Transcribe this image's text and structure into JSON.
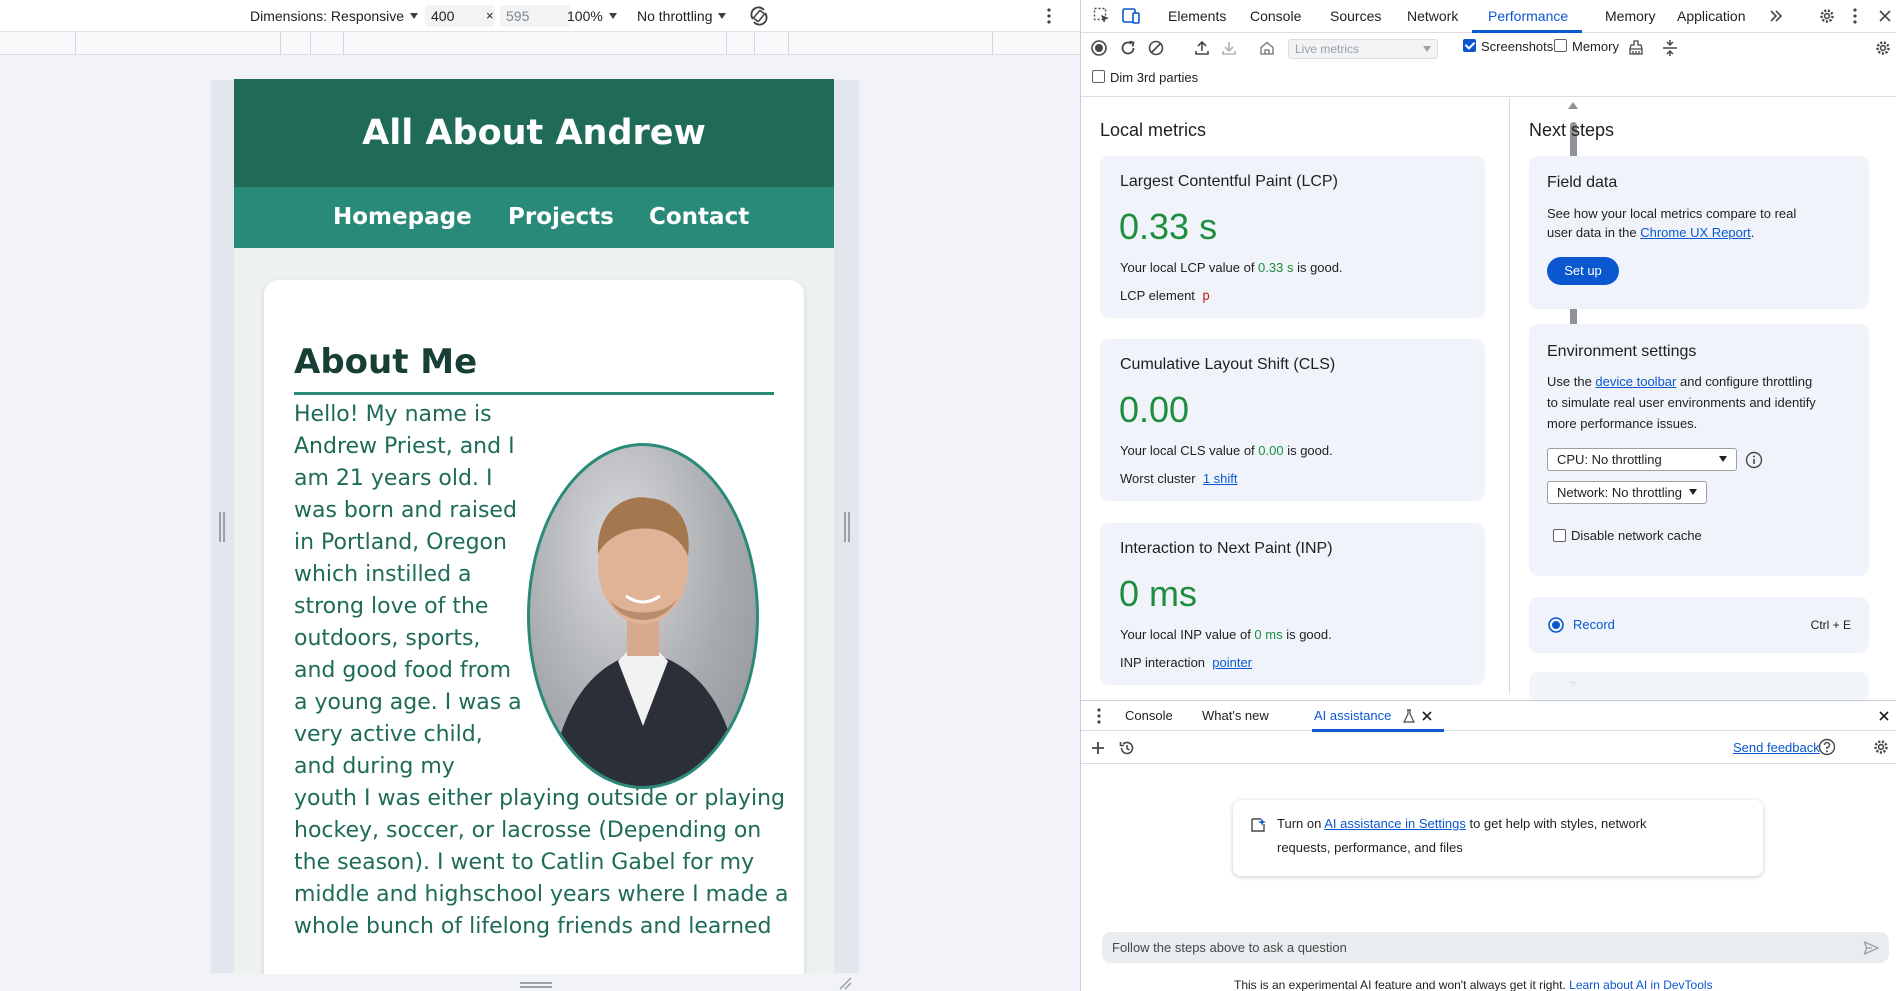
{
  "device_toolbar": {
    "dimensions_label": "Dimensions: Responsive",
    "width": "400",
    "x_sep": "×",
    "height": "595",
    "zoom": "100%",
    "throttling": "No throttling"
  },
  "site": {
    "title": "All About Andrew",
    "nav": [
      "Homepage",
      "Projects",
      "Contact"
    ],
    "heading": "About Me",
    "bio_lines": [
      "Hello! My name is",
      "Andrew Priest, and I",
      "am 21 years old. I",
      "was born and raised",
      "in Portland, Oregon",
      "which instilled a",
      "strong love of the",
      "outdoors, sports,",
      "and good food from",
      "a young age. I was a",
      "very active child,",
      "and during my",
      "youth I was either playing outside or playing",
      "hockey, soccer, or lacrosse (Depending on",
      "the season). I went to Catlin Gabel for my",
      "middle and highschool years where I made a",
      "whole bunch of lifelong friends and learned"
    ]
  },
  "devtools": {
    "tabs": [
      "Elements",
      "Console",
      "Sources",
      "Network",
      "Performance",
      "Memory",
      "Application"
    ],
    "active_tab": "Performance",
    "toolbar": {
      "live_metrics": "Live metrics",
      "screenshots_label": "Screenshots",
      "screenshots_checked": true,
      "memory_label": "Memory",
      "memory_checked": false,
      "dim_3rd_parties": "Dim 3rd parties"
    },
    "local_metrics": {
      "heading": "Local metrics",
      "lcp": {
        "title": "Largest Contentful Paint (LCP)",
        "value": "0.33 s",
        "desc_prefix": "Your local LCP value of ",
        "desc_value": "0.33 s",
        "desc_suffix": " is good.",
        "footer_label": "LCP element",
        "footer_value": "p"
      },
      "cls": {
        "title": "Cumulative Layout Shift (CLS)",
        "value": "0.00",
        "desc_prefix": "Your local CLS value of ",
        "desc_value": "0.00",
        "desc_suffix": " is good.",
        "footer_label": "Worst cluster",
        "footer_value": "1 shift"
      },
      "inp": {
        "title": "Interaction to Next Paint (INP)",
        "value": "0 ms",
        "desc_prefix": "Your local INP value of ",
        "desc_value": "0 ms",
        "desc_suffix": " is good.",
        "footer_label": "INP interaction",
        "footer_value": "pointer"
      }
    },
    "next_steps": {
      "heading": "Next steps",
      "field_data": {
        "title": "Field data",
        "text_1": "See how your local metrics compare to real",
        "text_2_prefix": "user data in the ",
        "text_2_link": "Chrome UX Report",
        "text_2_suffix": ".",
        "button": "Set up"
      },
      "environment": {
        "title": "Environment settings",
        "line_1_prefix": "Use the ",
        "line_1_link": "device toolbar",
        "line_1_suffix": " and configure throttling",
        "line_2": "to simulate real user environments and identify",
        "line_3": "more performance issues.",
        "cpu": "CPU: No throttling",
        "network": "Network: No throttling",
        "disable_cache": "Disable network cache"
      },
      "record": {
        "label": "Record",
        "shortcut": "Ctrl + E"
      }
    },
    "drawer": {
      "tabs": [
        "Console",
        "What's new",
        "AI assistance"
      ],
      "active_tab": "AI assistance",
      "send_feedback": "Send feedback",
      "ai_card": {
        "prefix": "Turn on ",
        "link": "AI assistance in Settings",
        "suffix": " to get help with styles, network",
        "line_2": "requests, performance, and files"
      },
      "input_placeholder": "Follow the steps above to ask a question",
      "disclaimer_prefix": "This is an experimental AI feature and won't always get it right. ",
      "disclaimer_link": "Learn about AI in DevTools"
    }
  },
  "colors": {
    "site_header": "#1f6b58",
    "site_nav": "#2a8a79",
    "metric_good": "#1e8e3e",
    "accent": "#0b57d0"
  }
}
